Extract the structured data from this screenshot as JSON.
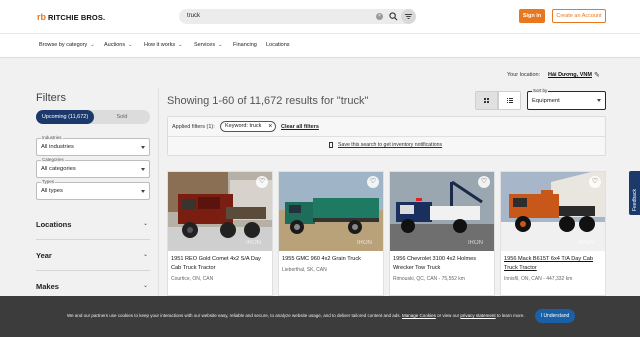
{
  "header": {
    "logo_mark": "rb",
    "logo_text": "RITCHIE BROS.",
    "search_value": "truck",
    "clear_glyph": "×",
    "signin_label": "Sign in",
    "create_label": "Create an Account"
  },
  "nav": {
    "items": [
      {
        "label": "Browse by category",
        "chevron": true
      },
      {
        "label": "Auctions",
        "chevron": true
      },
      {
        "label": "How it works",
        "chevron": true
      },
      {
        "label": "Services",
        "chevron": true
      },
      {
        "label": "Financing",
        "chevron": false
      },
      {
        "label": "Locations",
        "chevron": false
      }
    ]
  },
  "location": {
    "label": "Your location:",
    "value": "Hải Dương, VNM"
  },
  "sidebar": {
    "title": "Filters",
    "toggle_upcoming": "Upcoming (11,672)",
    "toggle_sold": "Sold",
    "selects": [
      {
        "label": "Industries",
        "value": "All industries"
      },
      {
        "label": "Categories",
        "value": "All categories"
      },
      {
        "label": "Types",
        "value": "All types"
      }
    ],
    "sections": [
      "Locations",
      "Year",
      "Makes"
    ]
  },
  "results": {
    "title": "Showing 1-60 of 11,672 results for \"truck\"",
    "sort_label": "Sort by",
    "sort_value": "Equipment"
  },
  "applied": {
    "label": "Applied filters (1):",
    "chip": "Keyword: truck",
    "chip_x": "×",
    "clear_all": "Clear all filters",
    "save_search": "Save this search to get inventory notifications"
  },
  "cards": [
    {
      "title": "1951 REO Gold Comet 4x2 S/A Day Cab Truck Tractor",
      "location": "Courtice, ON, CAN",
      "underline": false
    },
    {
      "title": "1955 GMC 960 4x2 Grain Truck",
      "location": "Lieberthal, SK, CAN",
      "underline": false
    },
    {
      "title": "1956 Chevrolet 3100 4x2 Holmes Wrecker Tow Truck",
      "location": "Rimouski, QC, CAN - 75,552 km",
      "underline": false
    },
    {
      "title": "1956 Mack B615T 6x4 T/A Day Cab Truck Tractor",
      "location": "Innisfil, ON, CAN - 447,332 km",
      "underline": true
    }
  ],
  "feedback_label": "Feedback",
  "cookie": {
    "text_before": "We and our partners use cookies to keep your interactions with our website easy, reliable and secure, to analyze website usage, and to deliver tailored content and ads.",
    "manage_link": "Manage Cookies",
    "text_mid": "or view our",
    "privacy_link": "privacy statement",
    "text_after": "to learn more.",
    "button": "I Understand"
  },
  "colors": {
    "accent": "#e8771d",
    "navy": "#1b3a6b",
    "cookie_bg": "#3c3c3c",
    "cookie_button": "#1b5fa6"
  }
}
